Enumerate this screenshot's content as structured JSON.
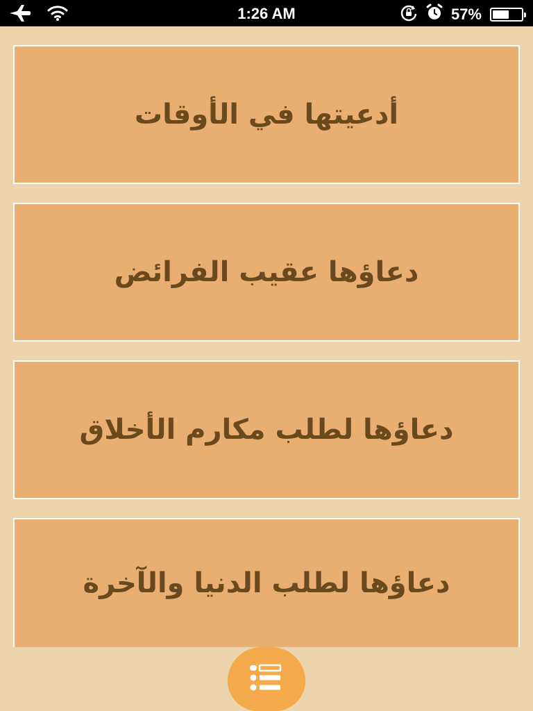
{
  "status_bar": {
    "time": "1:26 AM",
    "battery_percent_label": "57%",
    "battery_level": 0.57,
    "icons": [
      "airplane-icon",
      "wifi-icon",
      "rotation-lock-icon",
      "alarm-icon",
      "battery-icon"
    ]
  },
  "menu": {
    "items": [
      {
        "label": "أدعيتها في الأوقات"
      },
      {
        "label": "دعاؤها عقيب الفرائض"
      },
      {
        "label": "دعاؤها لطلب مكارم الأخلاق"
      },
      {
        "label": "دعاؤها لطلب الدنيا والآخرة"
      }
    ]
  },
  "fab": {
    "icon": "list-icon"
  },
  "colors": {
    "background": "#ecd5ad",
    "card": "#e9ae72",
    "card_text": "#6a4a1c",
    "fab": "#f4a94a"
  }
}
